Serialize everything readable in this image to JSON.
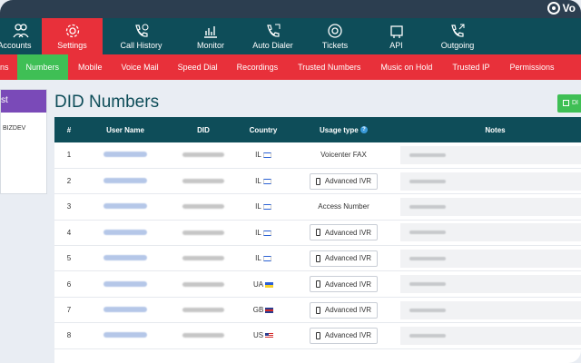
{
  "brand": {
    "name": "Vo"
  },
  "main_nav": [
    {
      "label": "Accounts",
      "icon": "users-icon"
    },
    {
      "label": "Settings",
      "icon": "gear-icon"
    },
    {
      "label": "Call History",
      "icon": "phone-history-icon"
    },
    {
      "label": "Monitor",
      "icon": "monitor-chart-icon"
    },
    {
      "label": "Auto Dialer",
      "icon": "auto-dialer-icon"
    },
    {
      "label": "Tickets",
      "icon": "lifebuoy-icon"
    },
    {
      "label": "API",
      "icon": "api-icon"
    },
    {
      "label": "Outgoing",
      "icon": "outgoing-call-icon"
    }
  ],
  "sub_nav": [
    "ns",
    "Numbers",
    "Mobile",
    "Voice Mail",
    "Speed Dial",
    "Recordings",
    "Trusted Numbers",
    "Music on Hold",
    "Trusted IP",
    "Permissions"
  ],
  "side_panel": {
    "header": "st",
    "item": "BIZDEV"
  },
  "page_title": "DID Numbers",
  "add_button": "DI",
  "table": {
    "headers": {
      "num": "#",
      "user": "User Name",
      "did": "DID",
      "country": "Country",
      "usage": "Usage type",
      "notes": "Notes"
    },
    "rows": [
      {
        "num": "1",
        "country": "IL",
        "flag": "il",
        "usage": "Voicenter FAX",
        "usage_button": false
      },
      {
        "num": "2",
        "country": "IL",
        "flag": "il",
        "usage": "Advanced IVR",
        "usage_button": true
      },
      {
        "num": "3",
        "country": "IL",
        "flag": "il",
        "usage": "Access Number",
        "usage_button": false
      },
      {
        "num": "4",
        "country": "IL",
        "flag": "il",
        "usage": "Advanced IVR",
        "usage_button": true
      },
      {
        "num": "5",
        "country": "IL",
        "flag": "il",
        "usage": "Advanced IVR",
        "usage_button": true
      },
      {
        "num": "6",
        "country": "UA",
        "flag": "ua",
        "usage": "Advanced IVR",
        "usage_button": true
      },
      {
        "num": "7",
        "country": "GB",
        "flag": "gb",
        "usage": "Advanced IVR",
        "usage_button": true
      },
      {
        "num": "8",
        "country": "US",
        "flag": "us",
        "usage": "Advanced IVR",
        "usage_button": true
      }
    ]
  },
  "colors": {
    "nav": "#0e4d59",
    "subnav": "#e8303a",
    "active_sub": "#3fbf55",
    "side_header": "#7a4ab8"
  }
}
